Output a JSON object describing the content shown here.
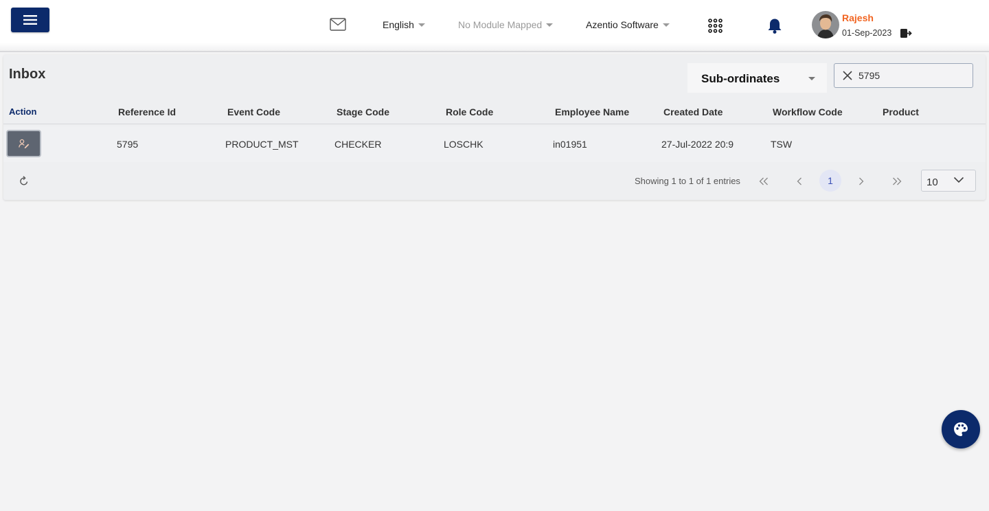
{
  "header": {
    "language": "English",
    "module": "No Module Mapped",
    "company": "Azentio Software",
    "user_name": "Rajesh",
    "user_date": "01-Sep-2023"
  },
  "inbox": {
    "title": "Inbox",
    "filter_selected": "Sub-ordinates",
    "search_value": "5795",
    "columns": [
      "Action",
      "Reference Id",
      "Event Code",
      "Stage Code",
      "Role Code",
      "Employee Name",
      "Created Date",
      "Workflow Code",
      "Product"
    ],
    "rows": [
      {
        "reference_id": "5795",
        "event_code": "PRODUCT_MST",
        "stage_code": "CHECKER",
        "role_code": "LOSCHK",
        "employee_name": "in01951",
        "created_date": "27-Jul-2022 20:9",
        "workflow_code": "TSW",
        "product": ""
      }
    ]
  },
  "pagination": {
    "showing_text": "Showing 1 to 1 of 1 entries",
    "current_page": "1",
    "page_size": "10"
  },
  "colors": {
    "primary": "#0c2a6b",
    "user_name": "#f26522",
    "action_button": "#5e6571"
  }
}
